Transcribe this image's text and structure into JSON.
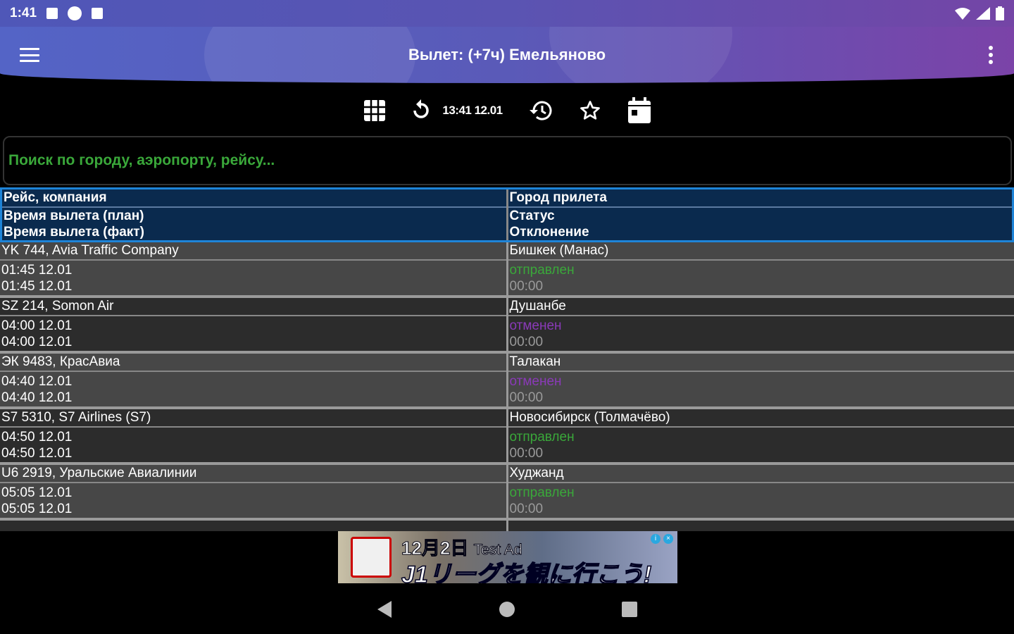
{
  "status": {
    "time": "1:41"
  },
  "appbar": {
    "title": "Вылет: (+7ч) Емельяново"
  },
  "toolbar": {
    "time": "13:41 12.01"
  },
  "search": {
    "placeholder": "Поиск по городу, аэропорту, рейсу..."
  },
  "table": {
    "header": {
      "left": [
        "Рейс, компания",
        "Время вылета (план)",
        "Время вылета (факт)"
      ],
      "right": [
        "Город прилета",
        "Статус",
        "Отклонение"
      ]
    },
    "rows": [
      {
        "flight": "YK 744, Avia Traffic Company",
        "plan": "01:45 12.01",
        "fact": "01:45 12.01",
        "city": "Бишкек (Манас)",
        "status": "отправлен",
        "status_type": "departed",
        "delay": "00:00"
      },
      {
        "flight": "SZ 214, Somon Air",
        "plan": "04:00 12.01",
        "fact": "04:00 12.01",
        "city": "Душанбе",
        "status": "отменен",
        "status_type": "cancelled",
        "delay": "00:00"
      },
      {
        "flight": "ЭК 9483, КрасАвиа",
        "plan": "04:40 12.01",
        "fact": "04:40 12.01",
        "city": "Талакан",
        "status": "отменен",
        "status_type": "cancelled",
        "delay": "00:00"
      },
      {
        "flight": "S7 5310, S7 Airlines (S7)",
        "plan": "04:50 12.01",
        "fact": "04:50 12.01",
        "city": "Новосибирск (Толмачёво)",
        "status": "отправлен",
        "status_type": "departed",
        "delay": "00:00"
      },
      {
        "flight": "U6 2919, Уральские Авиалинии",
        "plan": "05:05 12.01",
        "fact": "05:05 12.01",
        "city": "Худжанд",
        "status": "отправлен",
        "status_type": "departed",
        "delay": "00:00"
      }
    ]
  },
  "ad": {
    "line1": "12月2日",
    "label": "Test Ad",
    "line2": "J1リーグを観に行こう!"
  },
  "colors": {
    "accent": "#1e84d8",
    "departed": "#3aa83a",
    "cancelled": "#8a3ab8"
  }
}
